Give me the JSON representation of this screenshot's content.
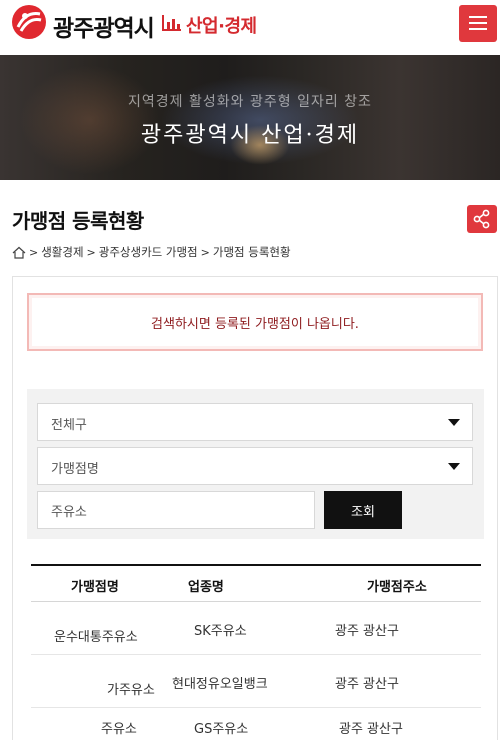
{
  "header": {
    "city_name": "광주광역시",
    "section_name": "산업·경제",
    "brand_color": "#e0282f",
    "menu_icon": "hamburger-icon"
  },
  "banner": {
    "subtitle": "지역경제 활성화와 광주형 일자리 창조",
    "title": "광주광역시 산업·경제"
  },
  "page": {
    "title": "가맹점 등록현황",
    "share_icon": "share-icon"
  },
  "breadcrumb": {
    "home_icon": "home-icon",
    "items": [
      "생활경제",
      "광주상생카드 가맹점",
      "가맹점 등록현황"
    ]
  },
  "notice": {
    "text": "검색하시면 등록된 가맹점이 나옵니다."
  },
  "search": {
    "district_select": "전체구",
    "type_select": "가맹점명",
    "keyword_value": "주유소",
    "submit_label": "조회"
  },
  "table": {
    "headers": [
      "가맹점명",
      "업종명",
      "가맹점주소"
    ],
    "rows": [
      {
        "name": "운수대통주유소",
        "category": "SK주유소",
        "address": "광주 광산구"
      },
      {
        "name": "가주유소",
        "category": "현대정유오일뱅크",
        "address": "광주 광산구"
      },
      {
        "name": "주유소",
        "category": "GS주유소",
        "address": "광주 광산구"
      }
    ]
  }
}
